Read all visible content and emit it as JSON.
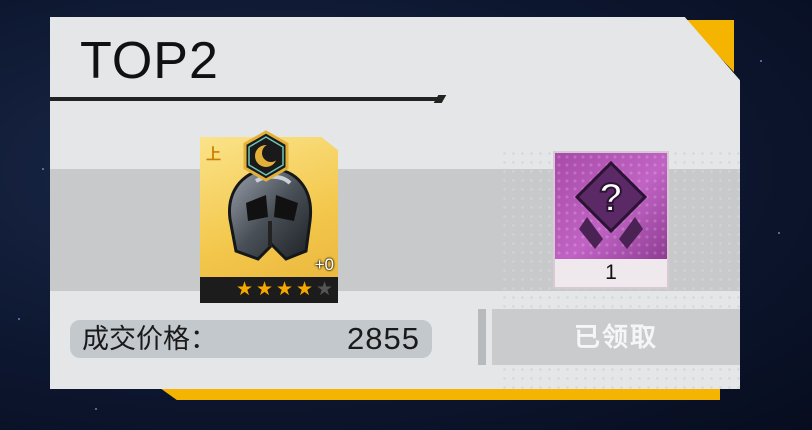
{
  "title": "TOP2",
  "reward_items": [
    {
      "name": "helmet",
      "tier_label": "上",
      "level": "+0",
      "stars_filled": 4,
      "stars_total": 5,
      "icon": "helmet-icon",
      "badge_icon": "crescent-moon-icon",
      "rarity_color": "#f3c74b"
    },
    {
      "name": "mystery",
      "icon": "question-mark-icon",
      "count": "1",
      "rarity_color": "#b457b8"
    }
  ],
  "price": {
    "label": "成交价格：",
    "value": "2855"
  },
  "claim_button": {
    "label": "已领取",
    "state": "disabled"
  },
  "colors": {
    "accent": "#f5b400",
    "background": "#0d1730",
    "card": "#e4e6e8"
  }
}
